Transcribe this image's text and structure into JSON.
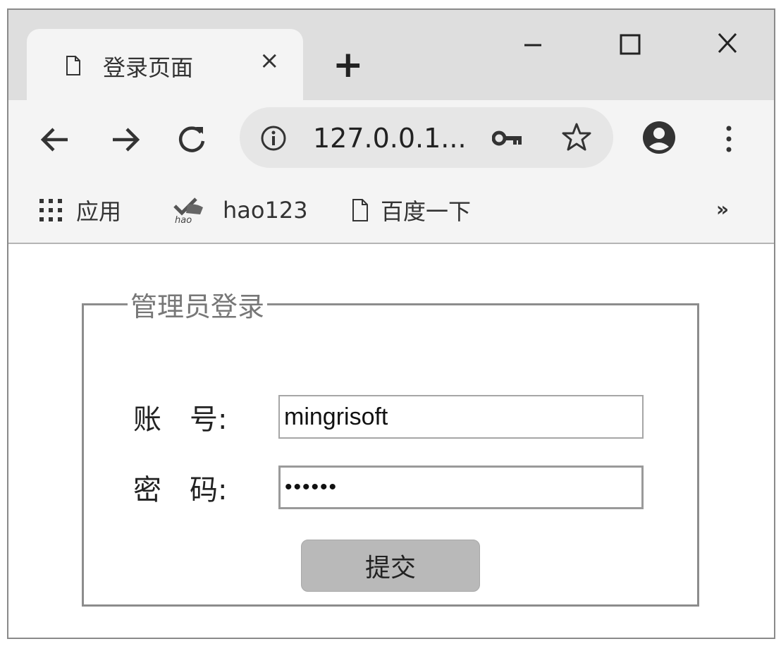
{
  "tab": {
    "title": "登录页面",
    "close": "×",
    "new_tab": "+"
  },
  "address_bar": {
    "url": "127.0.0.1..."
  },
  "bookmarks": {
    "items": [
      {
        "label": "应用",
        "icon": "apps-grid-icon"
      },
      {
        "label": "hao123",
        "icon": "hao123-logo-icon"
      },
      {
        "label": "百度一下",
        "icon": "page-icon"
      }
    ],
    "more": "»"
  },
  "login": {
    "legend": "管理员登录",
    "username_label": "账　号:",
    "username_value": "mingrisoft",
    "password_label": "密　码:",
    "password_value": "••••••",
    "submit_label": "提交"
  }
}
